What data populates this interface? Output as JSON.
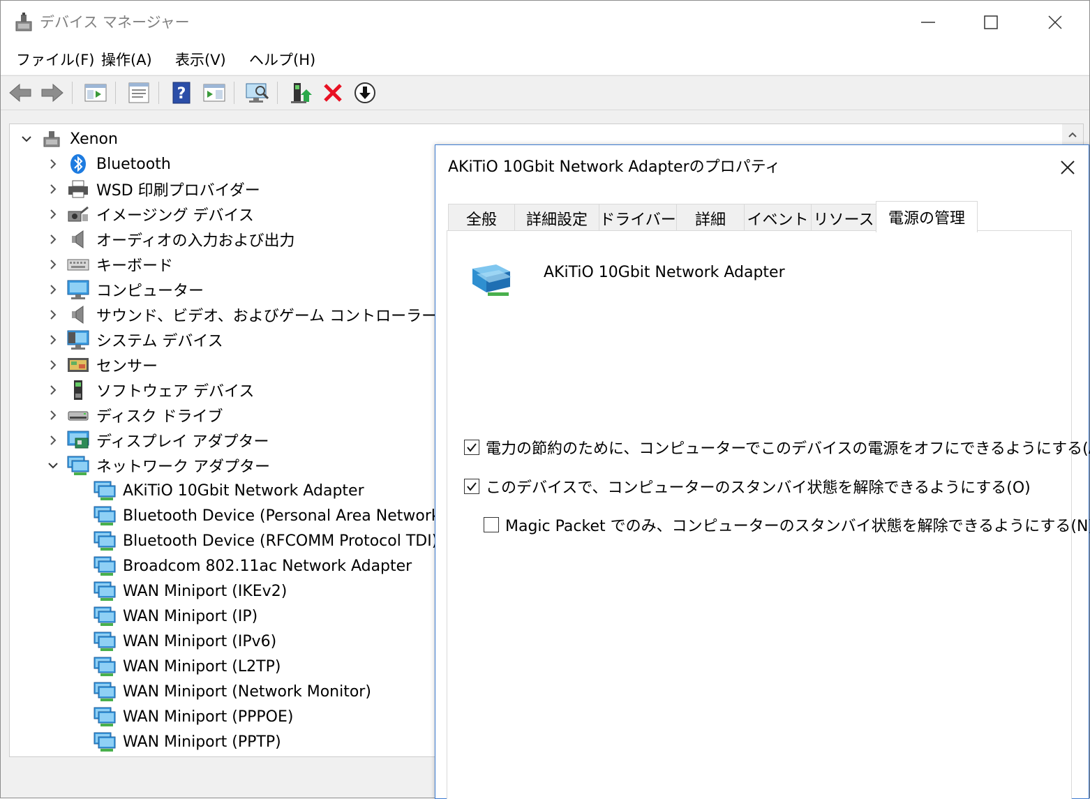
{
  "window": {
    "title": "デバイス マネージャー"
  },
  "menu": [
    {
      "label": "ファイル(F)"
    },
    {
      "label": "操作(A)"
    },
    {
      "label": "表示(V)"
    },
    {
      "label": "ヘルプ(H)"
    }
  ],
  "toolbar": {
    "icons": [
      "back-arrow-icon",
      "forward-arrow-icon",
      "show-hide-tree-icon",
      "properties-icon",
      "help-icon",
      "action-pane-icon",
      "scan-hardware-icon",
      "update-driver-icon",
      "uninstall-device-icon",
      "disable-device-icon"
    ]
  },
  "tree": {
    "root": {
      "label": "Xenon"
    },
    "categories": [
      {
        "label": "Bluetooth",
        "icon": "bluetooth-icon"
      },
      {
        "label": "WSD 印刷プロバイダー",
        "icon": "printer-icon"
      },
      {
        "label": "イメージング デバイス",
        "icon": "camera-icon"
      },
      {
        "label": "オーディオの入力および出力",
        "icon": "speaker-icon"
      },
      {
        "label": "キーボード",
        "icon": "keyboard-icon"
      },
      {
        "label": "コンピューター",
        "icon": "computer-icon"
      },
      {
        "label": "サウンド、ビデオ、およびゲーム コントローラー",
        "icon": "speaker-icon"
      },
      {
        "label": "システム デバイス",
        "icon": "system-devices-icon"
      },
      {
        "label": "センサー",
        "icon": "sensor-icon"
      },
      {
        "label": "ソフトウェア デバイス",
        "icon": "software-device-icon"
      },
      {
        "label": "ディスク ドライブ",
        "icon": "disk-drive-icon"
      },
      {
        "label": "ディスプレイ アダプター",
        "icon": "display-adapter-icon"
      },
      {
        "label": "ネットワーク アダプター",
        "icon": "network-adapter-icon"
      }
    ],
    "network_adapters": [
      {
        "label": "AKiTiO 10Gbit Network Adapter"
      },
      {
        "label": "Bluetooth Device (Personal Area Network)"
      },
      {
        "label": "Bluetooth Device (RFCOMM Protocol TDI)"
      },
      {
        "label": "Broadcom 802.11ac Network Adapter"
      },
      {
        "label": "WAN Miniport (IKEv2)"
      },
      {
        "label": "WAN Miniport (IP)"
      },
      {
        "label": "WAN Miniport (IPv6)"
      },
      {
        "label": "WAN Miniport (L2TP)"
      },
      {
        "label": "WAN Miniport (Network Monitor)"
      },
      {
        "label": "WAN Miniport (PPPOE)"
      },
      {
        "label": "WAN Miniport (PPTP)"
      }
    ]
  },
  "dialog": {
    "title": "AKiTiO 10Gbit Network Adapterのプロパティ",
    "tabs": [
      {
        "label": "全般"
      },
      {
        "label": "詳細設定"
      },
      {
        "label": "ドライバー"
      },
      {
        "label": "詳細"
      },
      {
        "label": "イベント"
      },
      {
        "label": "リソース"
      },
      {
        "label": "電源の管理",
        "active": true
      }
    ],
    "device_name": "AKiTiO 10Gbit Network Adapter",
    "options": [
      {
        "label": "電力の節約のために、コンピューターでこのデバイスの電源をオフにできるようにする(A)",
        "checked": true
      },
      {
        "label": "このデバイスで、コンピューターのスタンバイ状態を解除できるようにする(O)",
        "checked": true
      },
      {
        "label": "Magic Packet でのみ、コンピューターのスタンバイ状態を解除できるようにする(N)",
        "checked": false
      }
    ]
  },
  "colors": {
    "accent_border": "#3b7ad0",
    "uninstall_red": "#e81123",
    "help_blue": "#2b4ea8"
  }
}
